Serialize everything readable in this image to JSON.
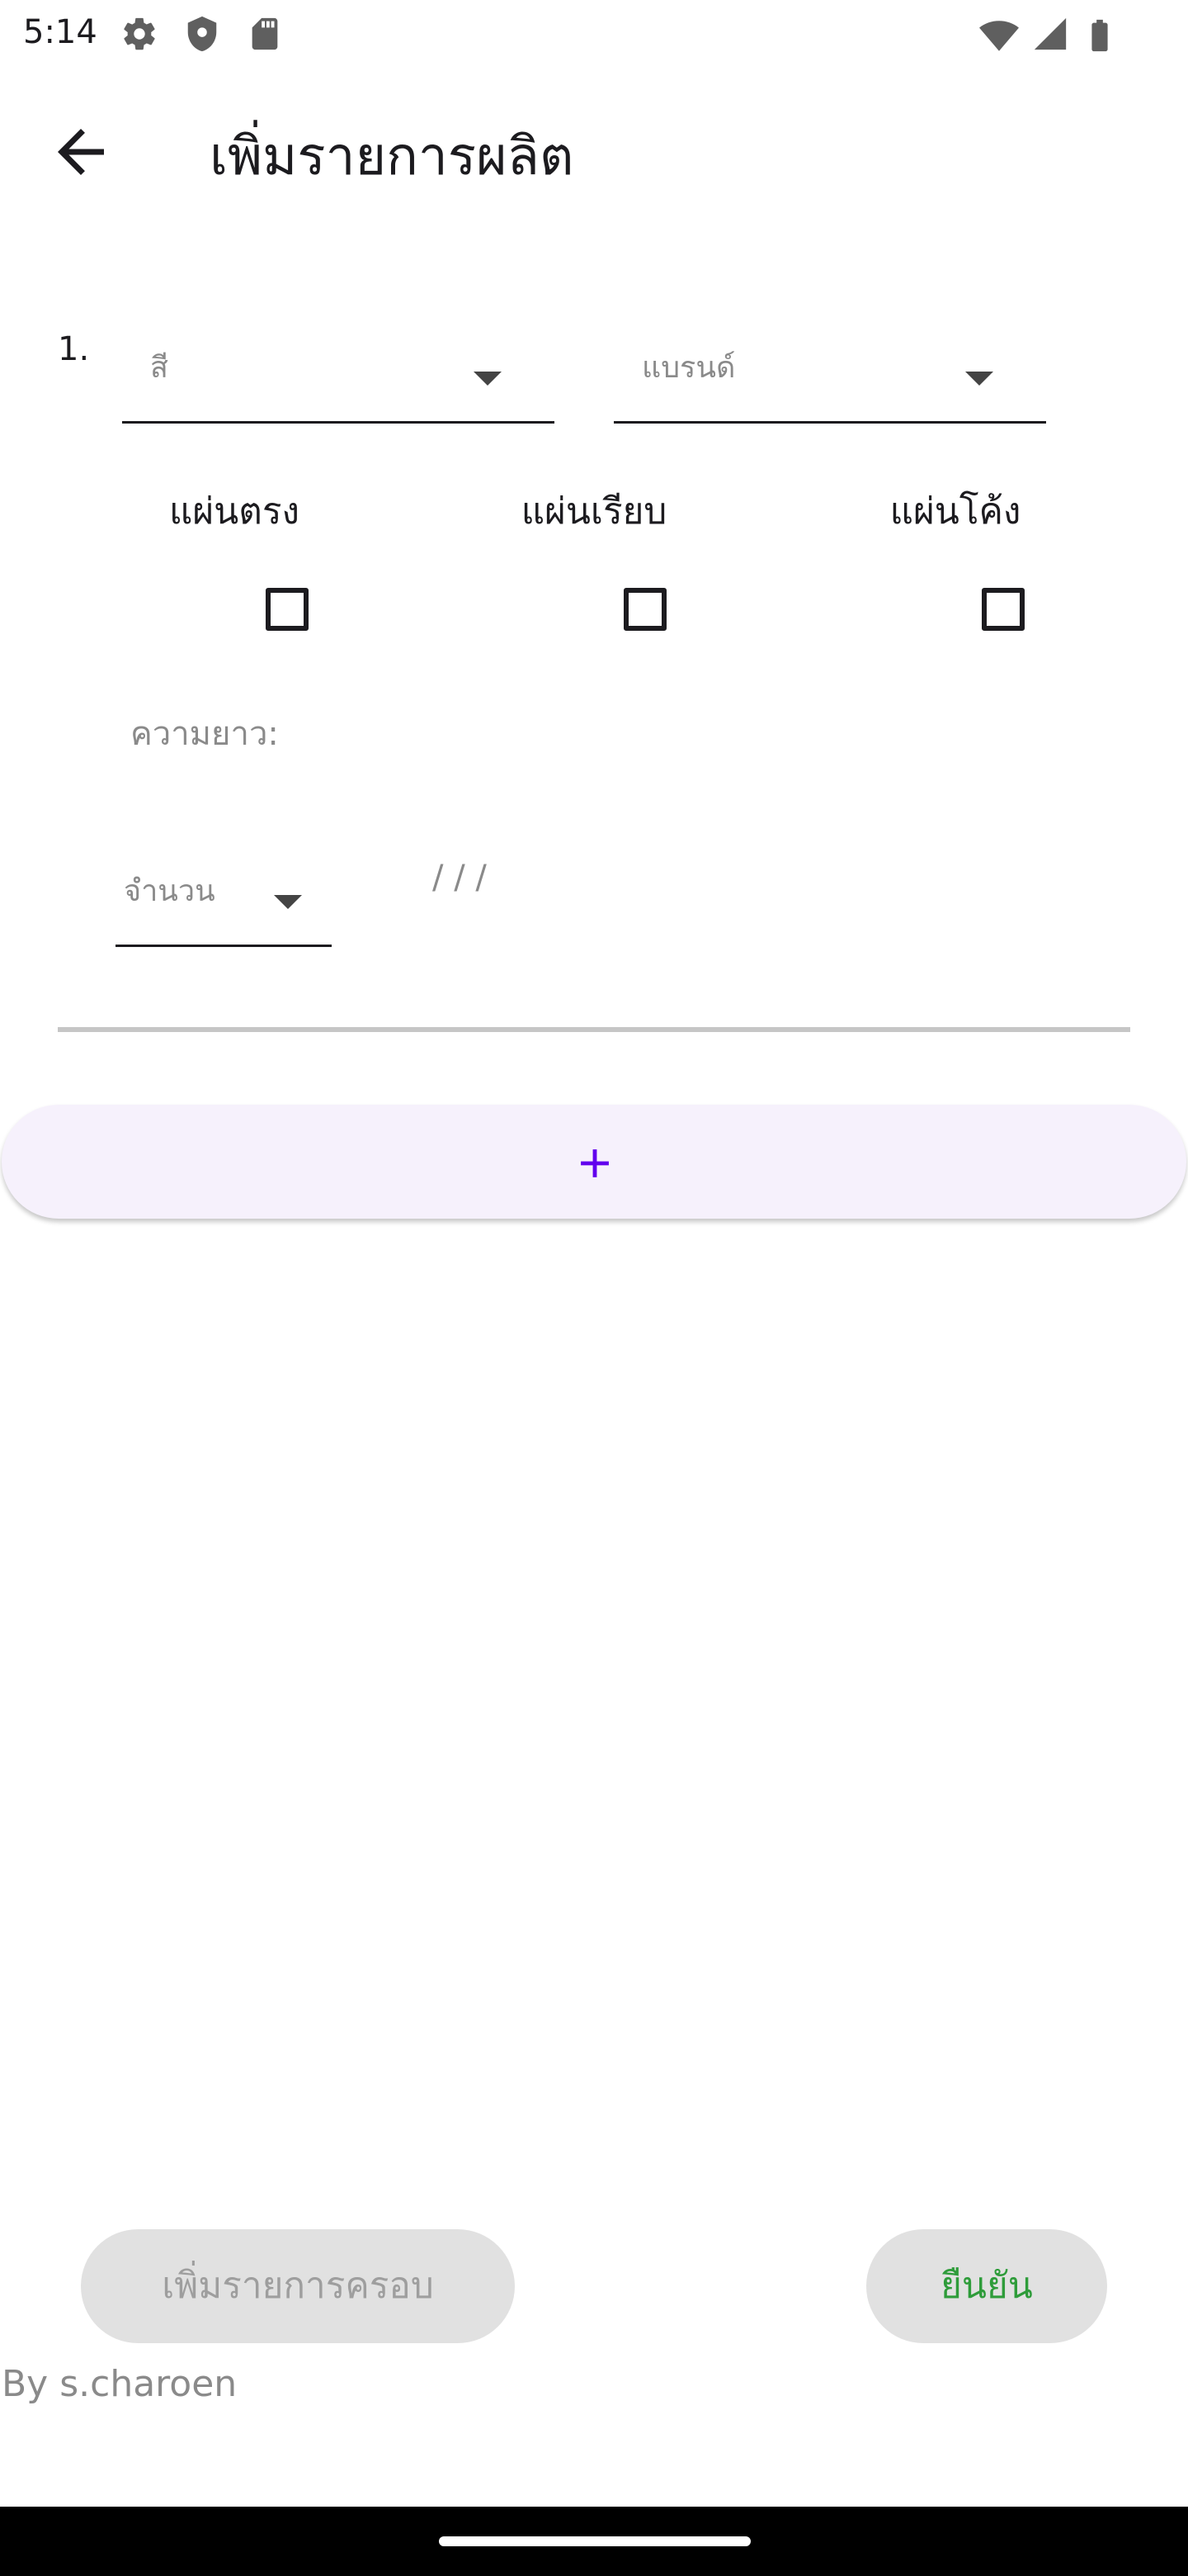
{
  "status_bar": {
    "time": "5:14",
    "icons": [
      "settings-icon",
      "shield-icon",
      "sd-card-icon",
      "wifi-icon",
      "signal-icon",
      "battery-icon"
    ]
  },
  "app_bar": {
    "back_icon": "arrow-back-icon",
    "title": "เพิ่มรายการผลิต"
  },
  "item": {
    "number": "1.",
    "color_dropdown": {
      "label": "สี",
      "value": ""
    },
    "brand_dropdown": {
      "label": "แบรนด์",
      "value": ""
    },
    "sheet_types": [
      {
        "label": "แผ่นตรง",
        "checked": false
      },
      {
        "label": "แผ่นเรียบ",
        "checked": false
      },
      {
        "label": "แผ่นโค้ง",
        "checked": false
      }
    ],
    "length_label": "ความยาว:",
    "quantity_dropdown": {
      "label": "จำนวน",
      "value": ""
    },
    "summary_text": "/ / /"
  },
  "add_item_button": {
    "icon": "plus-icon"
  },
  "footer": {
    "add_round_label": "เพิ่มรายการครอบ",
    "confirm_label": "ยืนยัน",
    "credit": "By s.charoen"
  },
  "colors": {
    "accent": "#6200ee",
    "add_button_bg": "#f6f1fc",
    "confirm_text": "#2e9c3a",
    "disabled_button_bg": "#e1e1e1"
  }
}
